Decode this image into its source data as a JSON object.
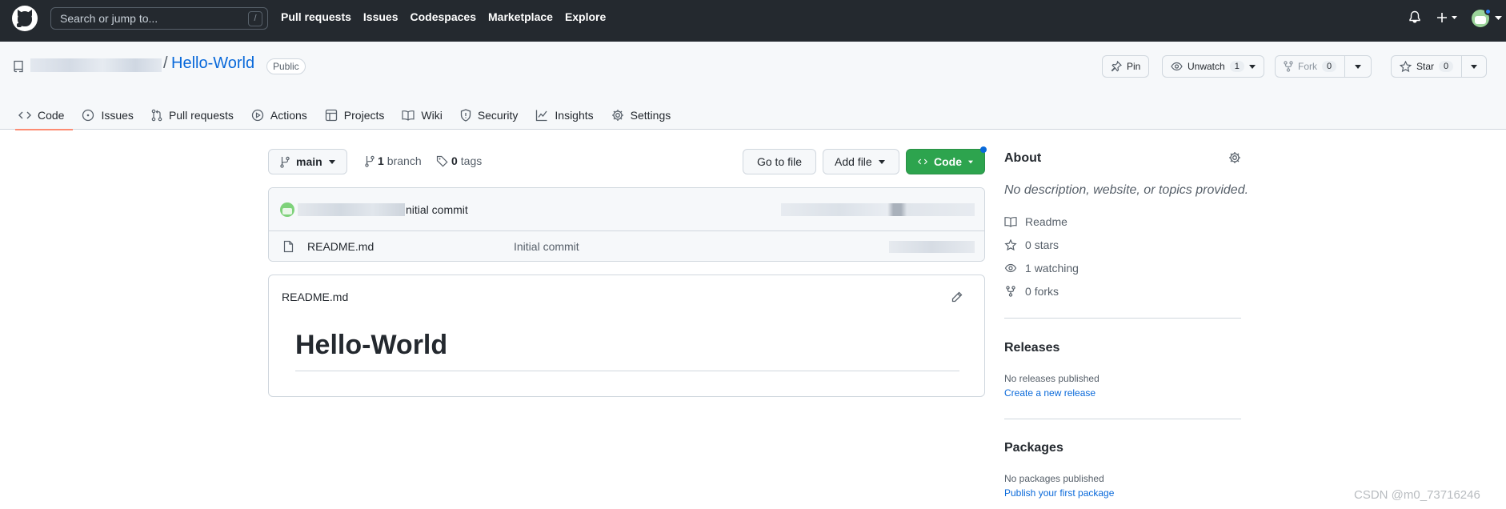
{
  "header": {
    "search_placeholder": "Search or jump to...",
    "search_shortcut": "/",
    "nav": [
      "Pull requests",
      "Issues",
      "Codespaces",
      "Marketplace",
      "Explore"
    ]
  },
  "repo": {
    "name": "Hello-World",
    "separator": "/",
    "visibility": "Public",
    "actions": {
      "pin": "Pin",
      "unwatch": "Unwatch",
      "unwatch_count": "1",
      "fork": "Fork",
      "fork_count": "0",
      "star": "Star",
      "star_count": "0"
    },
    "tabs": [
      "Code",
      "Issues",
      "Pull requests",
      "Actions",
      "Projects",
      "Wiki",
      "Security",
      "Insights",
      "Settings"
    ]
  },
  "toolbar": {
    "branch": "main",
    "branch_count": "1",
    "branch_label": "branch",
    "tag_count": "0",
    "tag_label": "tags",
    "go_to_file": "Go to file",
    "add_file": "Add file",
    "code": "Code"
  },
  "latest_commit": {
    "message": "nitial commit"
  },
  "files": [
    {
      "name": "README.md",
      "commit": "Initial commit"
    }
  ],
  "readme": {
    "title": "README.md",
    "heading": "Hello-World"
  },
  "sidebar": {
    "about_title": "About",
    "about_desc": "No description, website, or topics provided.",
    "items": [
      {
        "icon": "book-icon",
        "value": "",
        "label": "Readme"
      },
      {
        "icon": "star-icon",
        "value": "0",
        "label": "stars"
      },
      {
        "icon": "eye-icon",
        "value": "1",
        "label": "watching"
      },
      {
        "icon": "fork-icon",
        "value": "0",
        "label": "forks"
      }
    ],
    "releases_title": "Releases",
    "releases_note": "No releases published",
    "releases_link": "Create a new release",
    "packages_title": "Packages",
    "packages_note": "No packages published",
    "packages_link": "Publish your first package"
  },
  "watermark": "CSDN @m0_73716246",
  "colors": {
    "header_bg": "#24292f",
    "link": "#0969da",
    "code_button": "#2da44e",
    "active_tab": "#fd8c73"
  }
}
